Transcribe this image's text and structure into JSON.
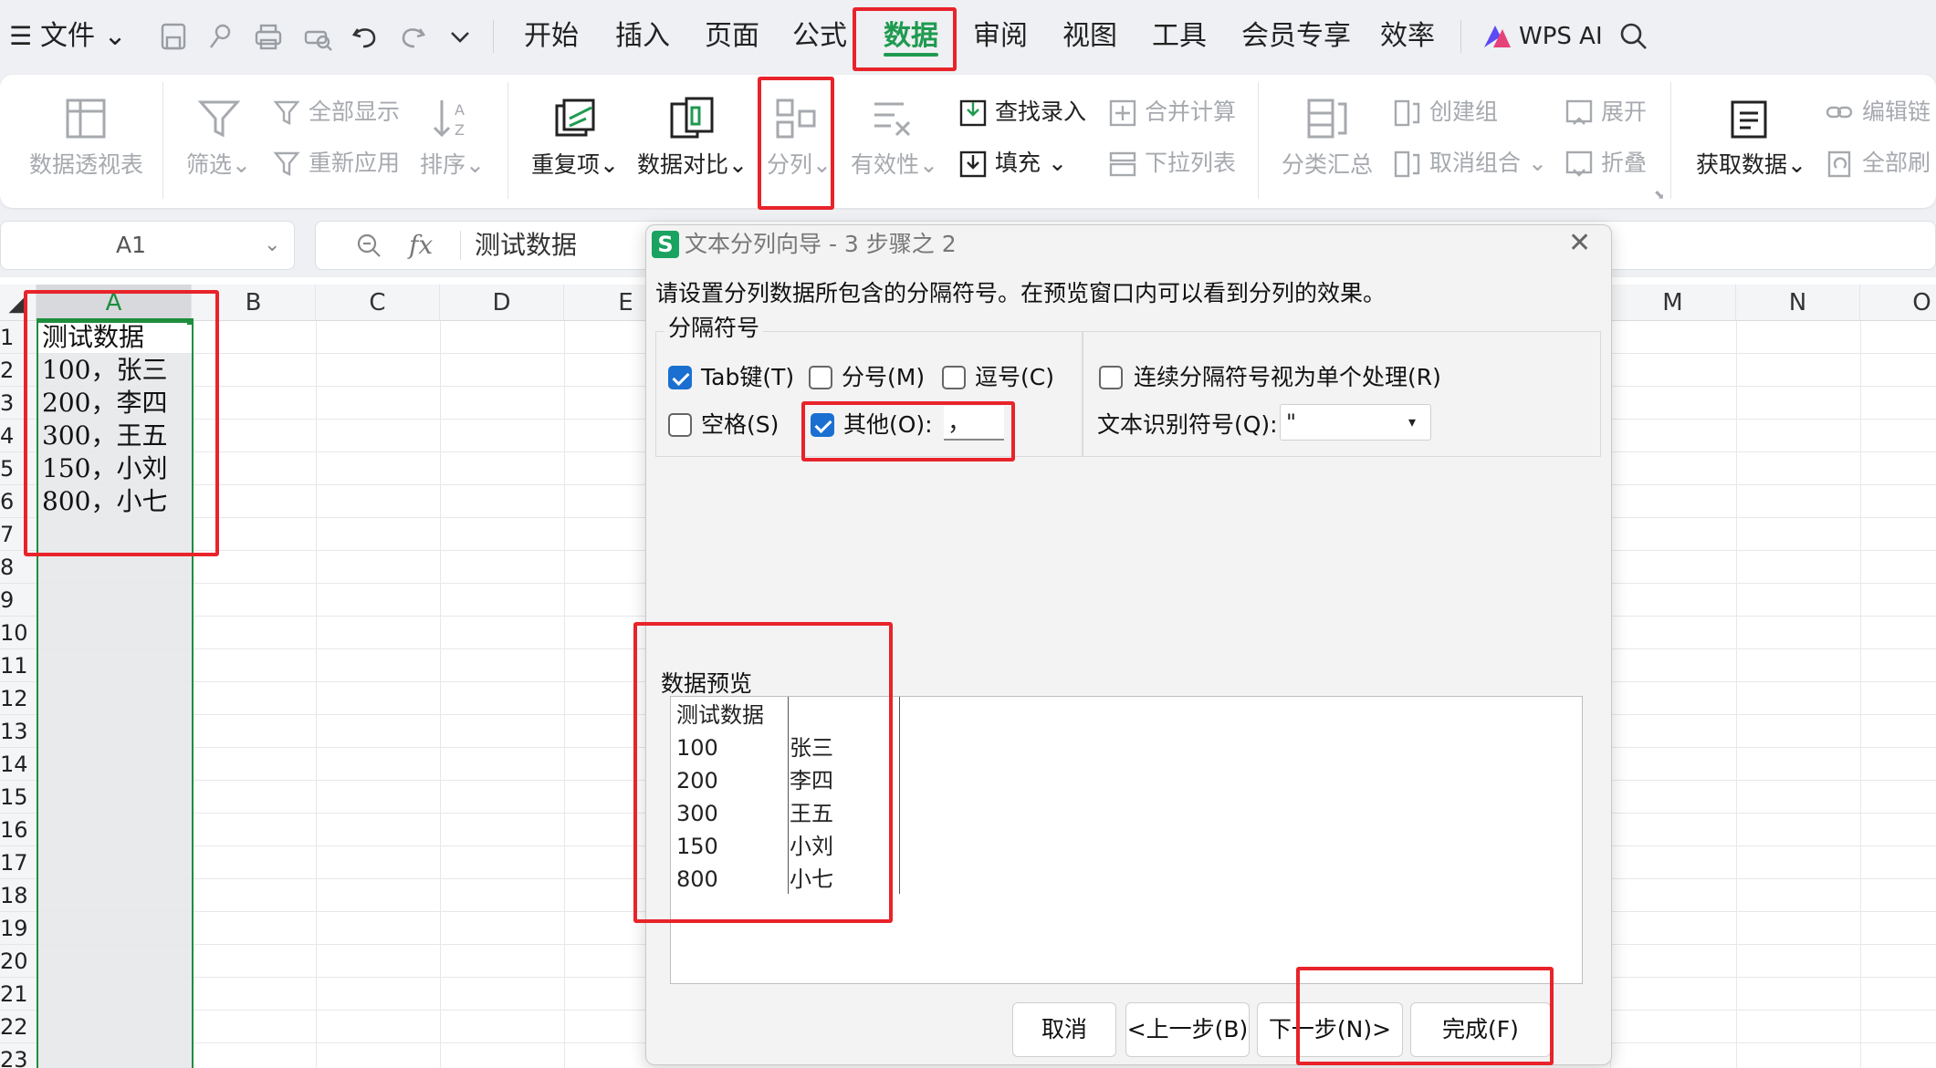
{
  "menubar": {
    "file": "文件",
    "tabs": [
      "开始",
      "插入",
      "页面",
      "公式",
      "数据",
      "审阅",
      "视图",
      "工具",
      "会员专享",
      "效率"
    ],
    "active_tab": "数据",
    "wps_ai": "WPS AI"
  },
  "ribbon": {
    "pivot": "数据透视表",
    "filter": "筛选",
    "show_all": "全部显示",
    "reapply": "重新应用",
    "sort": "排序",
    "duplicates": "重复项",
    "compare": "数据对比",
    "split": "分列",
    "validity": "有效性",
    "lookup_entry": "查找录入",
    "fill": "填充",
    "consolidate": "合并计算",
    "dropdown_list": "下拉列表",
    "subtotal": "分类汇总",
    "create_group": "创建组",
    "ungroup": "取消组合",
    "expand": "展开",
    "collapse": "折叠",
    "get_data": "获取数据",
    "edit_links": "编辑链",
    "refresh_all": "全部刷"
  },
  "formula_bar": {
    "cell_ref": "A1",
    "fx": "fx",
    "content": "测试数据"
  },
  "grid": {
    "columns": [
      "A",
      "B",
      "C",
      "D",
      "E",
      "M",
      "N",
      "O"
    ],
    "rows": [
      "1",
      "2",
      "3",
      "4",
      "5",
      "6",
      "7",
      "8",
      "9",
      "10",
      "11",
      "12",
      "13",
      "14",
      "15",
      "16",
      "17",
      "18",
      "19",
      "20",
      "21",
      "22",
      "23"
    ],
    "cells": [
      "测试数据",
      "100，张三",
      "200，李四",
      "300，王五",
      "150，小刘",
      "800，小七"
    ]
  },
  "dialog": {
    "title": "文本分列向导 - 3 步骤之 2",
    "instruction": "请设置分列数据所包含的分隔符号。在预览窗口内可以看到分列的效果。",
    "delimiters_group": "分隔符号",
    "tab": "Tab键(T)",
    "semicolon": "分号(M)",
    "comma": "逗号(C)",
    "space": "空格(S)",
    "other": "其他(O):",
    "other_value": "，",
    "consecutive": "连续分隔符号视为单个处理(R)",
    "qualifier_label": "文本识别符号(Q):",
    "qualifier_value": "\"",
    "checked": {
      "tab": true,
      "semicolon": false,
      "comma": false,
      "space": false,
      "other": true,
      "consecutive": false
    },
    "preview_label": "数据预览",
    "preview": [
      [
        "测试数据",
        ""
      ],
      [
        "100",
        "张三"
      ],
      [
        "200",
        "李四"
      ],
      [
        "300",
        "王五"
      ],
      [
        "150",
        "小刘"
      ],
      [
        "800",
        "小七"
      ]
    ],
    "buttons": {
      "cancel": "取消",
      "back": "<上一步(B)",
      "next": "下一步(N)>",
      "finish": "完成(F)"
    }
  },
  "colors": {
    "highlight": "#e8232a",
    "check": "#1a6fd1",
    "selection": "#1e8e3e",
    "sheet_icon": "#1aa260"
  }
}
